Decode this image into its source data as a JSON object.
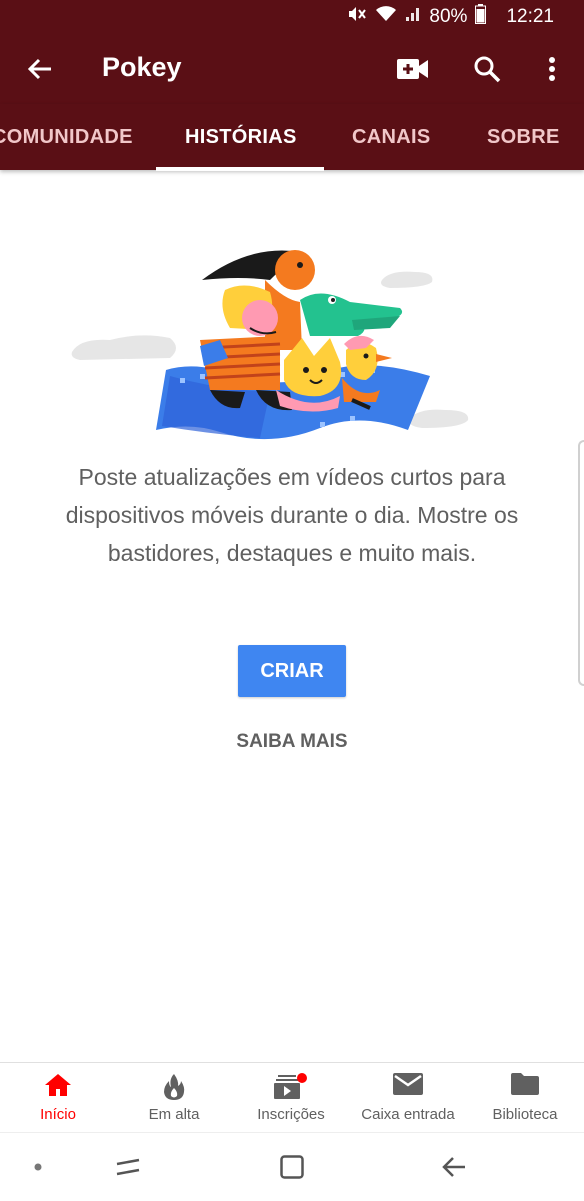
{
  "status_bar": {
    "battery": "80%",
    "time": "12:21",
    "icons": [
      "mute-vibrate-icon",
      "wifi-icon",
      "signal-icon",
      "battery-icon"
    ]
  },
  "app_bar": {
    "title": "Pokey",
    "background_color": "#5a0f15",
    "actions": [
      "add-video-icon",
      "search-icon",
      "more-vert-icon"
    ]
  },
  "tabs": [
    {
      "label": "COMUNIDADE",
      "active": false
    },
    {
      "label": "HISTÓRIAS",
      "active": true
    },
    {
      "label": "CANAIS",
      "active": false
    },
    {
      "label": "SOBRE",
      "active": false
    }
  ],
  "main": {
    "description": "Poste atualizações em vídeos curtos para dispositivos móveis durante o dia. Mostre os bastidores, destaques e muito mais.",
    "create_label": "CRIAR",
    "learn_more_label": "SAIBA MAIS",
    "accent_color": "#3f86f1"
  },
  "bottom_nav": [
    {
      "label": "Início",
      "icon": "home-icon",
      "active": true
    },
    {
      "label": "Em alta",
      "icon": "trending-flame-icon",
      "active": false
    },
    {
      "label": "Inscrições",
      "icon": "subscriptions-icon",
      "active": false,
      "badge": true
    },
    {
      "label": "Caixa entrada",
      "icon": "mail-icon",
      "active": false
    },
    {
      "label": "Biblioteca",
      "icon": "folder-icon",
      "active": false
    }
  ],
  "system_nav": [
    "dot-indicator",
    "recent-apps-icon",
    "home-square-icon",
    "back-arrow-icon"
  ]
}
